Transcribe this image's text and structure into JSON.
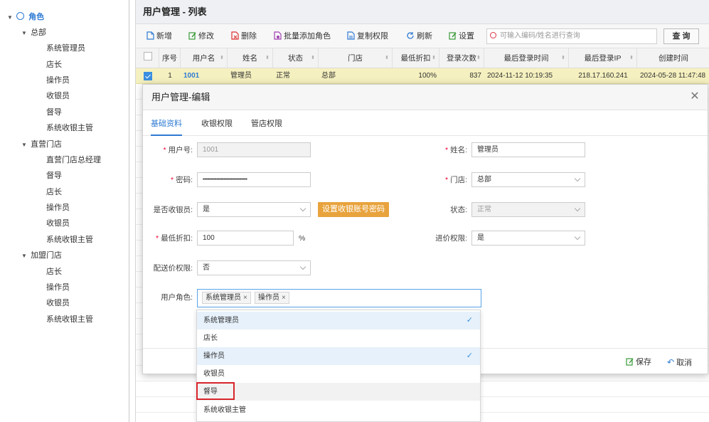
{
  "sidebar": {
    "root": "角色",
    "groups": [
      {
        "label": "总部",
        "items": [
          "系统管理员",
          "店长",
          "操作员",
          "收银员",
          "督导",
          "系统收银主管"
        ]
      },
      {
        "label": "直营门店",
        "items": [
          "直营门店总经理",
          "督导",
          "店长",
          "操作员",
          "收银员",
          "系统收银主管"
        ]
      },
      {
        "label": "加盟门店",
        "items": [
          "店长",
          "操作员",
          "收银员",
          "系统收银主管"
        ]
      }
    ]
  },
  "page": {
    "title": "用户管理 - 列表"
  },
  "toolbar": {
    "add": "新增",
    "edit": "修改",
    "delete": "删除",
    "batch_add_role": "批量添加角色",
    "copy_permissions": "复制权限",
    "refresh": "刷新",
    "settings": "设置",
    "search_placeholder": "可输入编码/姓名进行查询",
    "search_button": "查 询"
  },
  "grid": {
    "columns": [
      "序号",
      "用户名",
      "姓名",
      "状态",
      "门店",
      "最低折扣",
      "登录次数",
      "最后登录时间",
      "最后登录IP",
      "创建时间"
    ],
    "rows": [
      {
        "index": "1",
        "username": "1001",
        "name": "管理员",
        "status": "正常",
        "store": "总部",
        "min_discount": "100%",
        "login_count": "837",
        "last_login": "2024-11-12 10:19:35",
        "last_ip": "218.17.160.241",
        "created": "2024-05-28 11:47:48"
      }
    ]
  },
  "modal": {
    "title": "用户管理-编辑",
    "tabs": [
      "基础资料",
      "收银权限",
      "管店权限"
    ],
    "fields": {
      "user_no_label": "用户号:",
      "user_no": "1001",
      "name_label": "姓名:",
      "name": "管理员",
      "password_label": "密码:",
      "password": "••••••••••••••••••••••••••••••••",
      "store_label": "门店:",
      "store": "总部",
      "is_cashier_label": "是否收银员:",
      "is_cashier": "是",
      "set_cashier_pwd": "设置收银账号密码",
      "status_label": "状态:",
      "status": "正常",
      "min_discount_label": "最低折扣:",
      "min_discount": "100",
      "percent": "%",
      "purchase_price_label": "进价权限:",
      "purchase_price": "是",
      "delivery_price_label": "配送价权限:",
      "delivery_price": "否",
      "user_role_label": "用户角色:"
    },
    "role_tags": [
      "系统管理员",
      "操作员"
    ],
    "save": "保存",
    "cancel": "取消"
  },
  "role_dropdown": [
    {
      "label": "系统管理员",
      "selected": true
    },
    {
      "label": "店长",
      "selected": false
    },
    {
      "label": "操作员",
      "selected": true
    },
    {
      "label": "收银员",
      "selected": false
    },
    {
      "label": "督导",
      "selected": false,
      "highlighted": true
    },
    {
      "label": "系统收银主管",
      "selected": false
    }
  ],
  "check_mark": "✓",
  "colors": {
    "accent": "#2f7bd3",
    "orange": "#e8a33d",
    "row_highlight": "#f5f0bf",
    "red_box": "#d9252c"
  }
}
